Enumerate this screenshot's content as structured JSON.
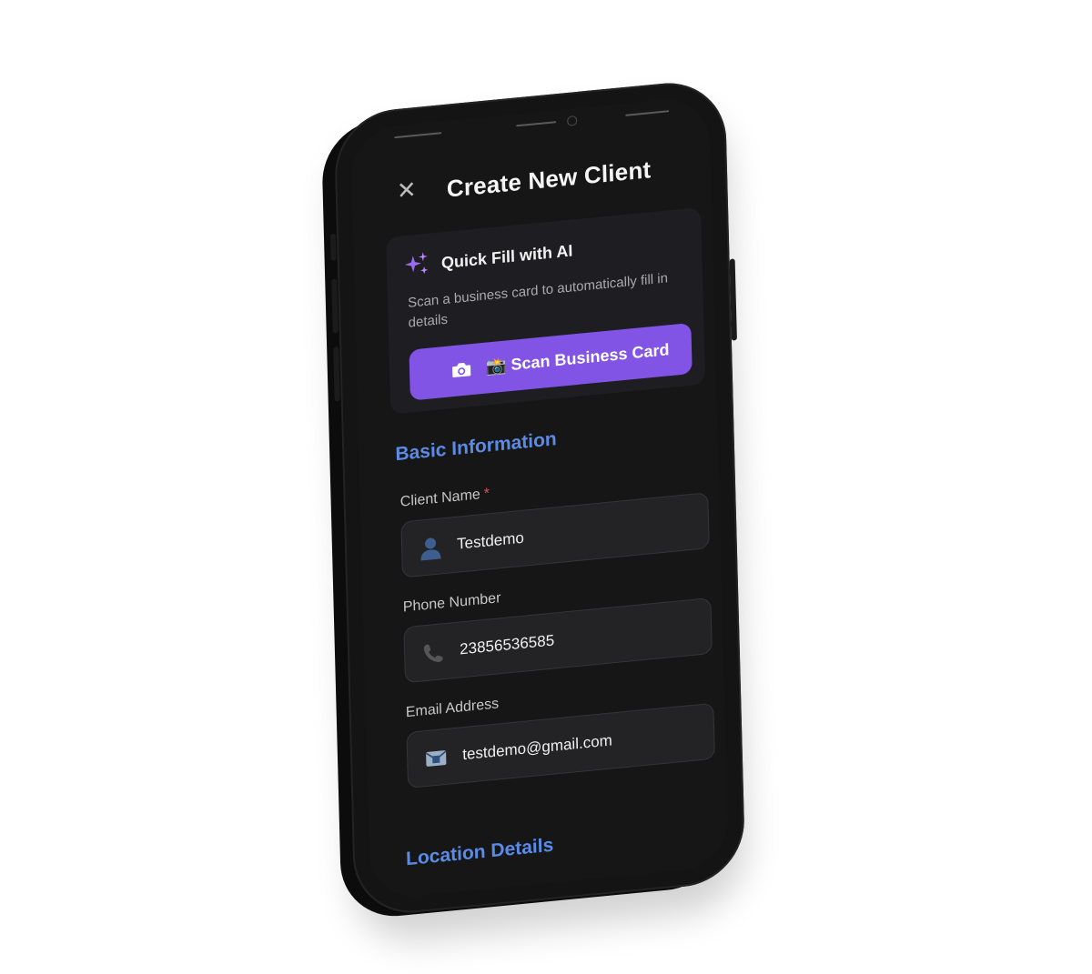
{
  "header": {
    "title": "Create New Client",
    "close_icon": "close-icon"
  },
  "ai_card": {
    "icon": "sparkle-icon",
    "title": "Quick Fill with AI",
    "description": "Scan a business card to automatically fill in details",
    "button_icon": "camera-icon",
    "button_label": "📸 Scan Business Card"
  },
  "sections": {
    "basic_information": "Basic Information",
    "location_details": "Location Details"
  },
  "fields": {
    "client_name": {
      "label": "Client Name",
      "required_mark": "*",
      "value": "Testdemo",
      "icon": "person-icon"
    },
    "phone_number": {
      "label": "Phone Number",
      "value": "23856536585",
      "icon": "phone-icon"
    },
    "email_address": {
      "label": "Email Address",
      "value": "testdemo@gmail.com",
      "icon": "envelope-icon"
    }
  },
  "colors": {
    "accent": "#8254e6",
    "section_title": "#5b8be6",
    "screen_bg": "#161616",
    "field_bg": "#232325",
    "required": "#e05555"
  }
}
